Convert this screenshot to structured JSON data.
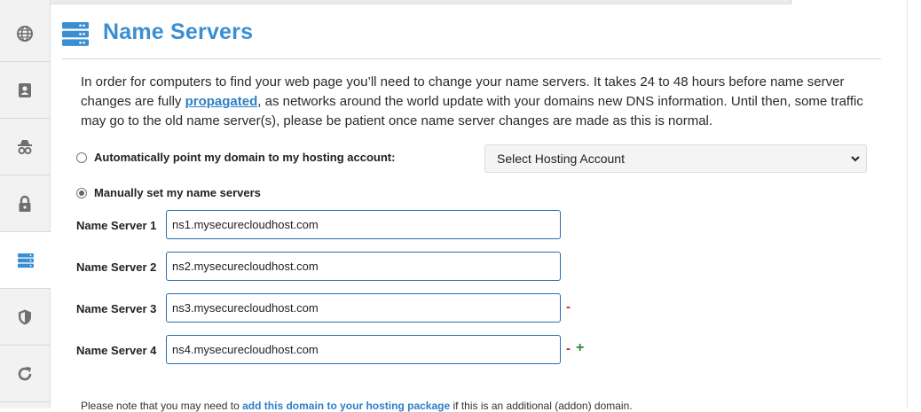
{
  "sidebar": {
    "items": [
      {
        "icon": "globe-icon"
      },
      {
        "icon": "contact-card-icon"
      },
      {
        "icon": "incognito-icon"
      },
      {
        "icon": "lock-icon"
      },
      {
        "icon": "server-icon",
        "active": true
      },
      {
        "icon": "shield-icon"
      },
      {
        "icon": "refresh-icon"
      }
    ]
  },
  "header": {
    "title": "Name Servers",
    "icon": "server-icon",
    "accent_color": "#3a8fd3"
  },
  "intro": {
    "before_link": "In order for computers to find your web page you’ll need to change your name servers. It takes 24 to 48 hours before name server changes are fully ",
    "link_text": "propagated",
    "after_link": ", as networks around the world update with your domains new DNS information. Until then, some traffic may go to the old name server(s), please be patient once name server changes are made as this is normal."
  },
  "options": {
    "auto_label": "Automatically point my domain to my hosting account:",
    "auto_selected": false,
    "manual_label": "Manually set my name servers",
    "manual_selected": true,
    "hosting_select_value": "Select Hosting Account"
  },
  "name_servers": [
    {
      "label": "Name Server 1",
      "value": "ns1.mysecurecloudhost.com"
    },
    {
      "label": "Name Server 2",
      "value": "ns2.mysecurecloudhost.com"
    },
    {
      "label": "Name Server 3",
      "value": "ns3.mysecurecloudhost.com",
      "remove": "-"
    },
    {
      "label": "Name Server 4",
      "value": "ns4.mysecurecloudhost.com",
      "remove": "-",
      "add": "+"
    }
  ],
  "note": {
    "before_link": "Please note that you may need to ",
    "link_text": "add this domain to your hosting package",
    "after_link": " if this is an additional (addon) domain."
  }
}
